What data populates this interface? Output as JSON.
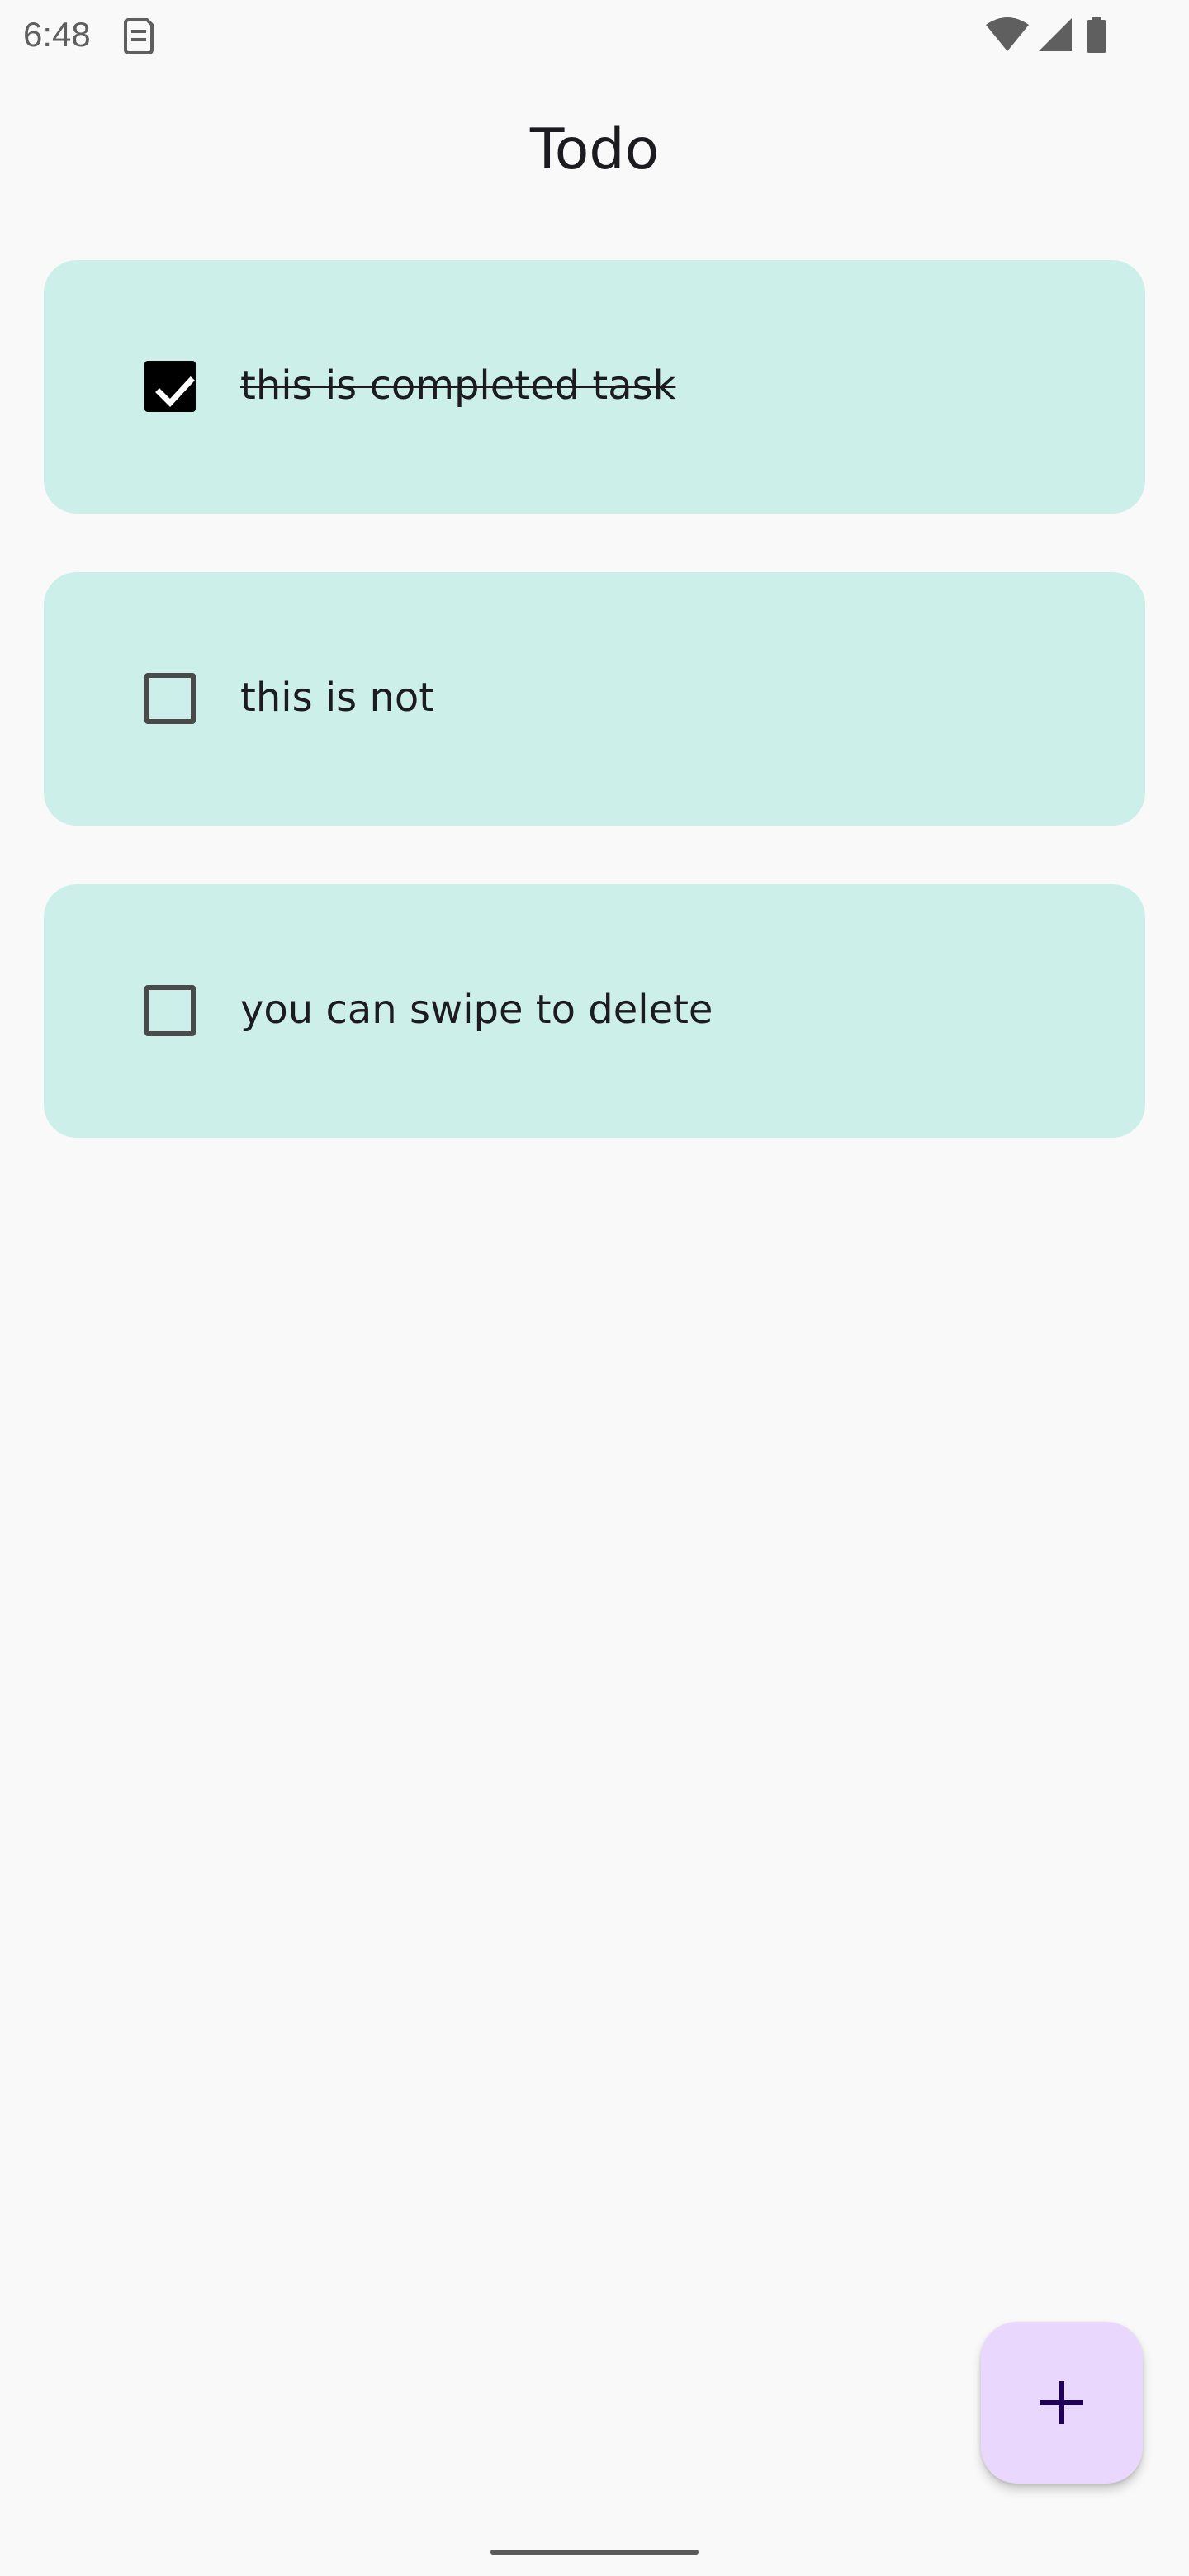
{
  "status_bar": {
    "time": "6:48",
    "icons": [
      "sim-card-icon",
      "wifi-icon",
      "cellular-signal-icon",
      "battery-icon"
    ]
  },
  "app": {
    "title": "Todo"
  },
  "todos": [
    {
      "text": "this is completed task",
      "completed": true
    },
    {
      "text": "this is not",
      "completed": false
    },
    {
      "text": "you can swipe to delete",
      "completed": false
    }
  ],
  "fab": {
    "icon": "plus-icon"
  },
  "colors": {
    "background": "#f9f9f9",
    "card": "#ccefe9",
    "fab": "#ead7fd",
    "fab_icon": "#21005d",
    "checkbox_checked": "#000000",
    "checkbox_border": "#4a4a4a"
  }
}
